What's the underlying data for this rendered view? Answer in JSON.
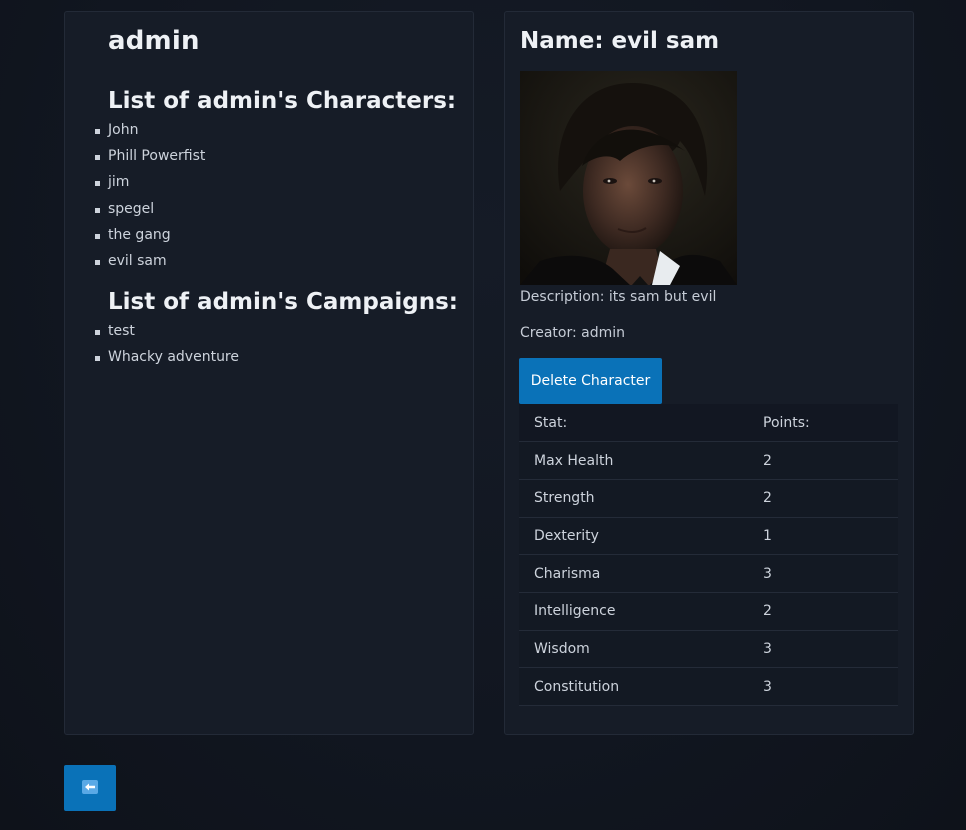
{
  "user": {
    "name": "admin"
  },
  "characters_section": {
    "heading": "List of admin's Characters:",
    "items": [
      "John",
      "Phill Powerfist",
      "jim",
      "spegel",
      "the gang",
      "evil sam"
    ]
  },
  "campaigns_section": {
    "heading": "List of admin's Campaigns:",
    "items": [
      "test",
      "Whacky adventure"
    ]
  },
  "character": {
    "name_line": "Name: evil sam",
    "description_line": "Description: its sam but evil",
    "creator_line": "Creator: admin",
    "delete_label": "Delete Character",
    "portrait_icon": "character-portrait"
  },
  "stats_table": {
    "headers": [
      "Stat:",
      "Points:"
    ],
    "rows": [
      [
        "Max Health",
        "2"
      ],
      [
        "Strength",
        "2"
      ],
      [
        "Dexterity",
        "1"
      ],
      [
        "Charisma",
        "3"
      ],
      [
        "Intelligence",
        "2"
      ],
      [
        "Wisdom",
        "3"
      ],
      [
        "Constitution",
        "3"
      ]
    ]
  },
  "back_button": {
    "icon": "back-arrow-icon"
  },
  "colors": {
    "accent": "#0a72b8",
    "background": "#121722",
    "panel": "#161c27"
  }
}
